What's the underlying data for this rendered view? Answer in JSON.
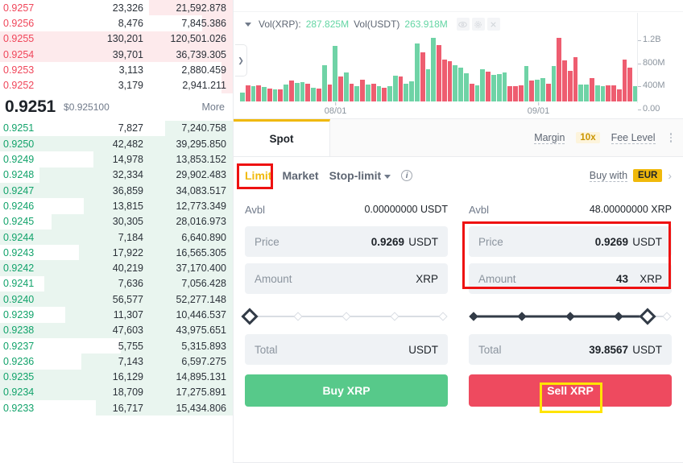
{
  "orderbook": {
    "asks": [
      {
        "price": "0.9257",
        "amount": "23,326",
        "total": "21,592.878",
        "depth": 36
      },
      {
        "price": "0.9256",
        "amount": "8,476",
        "total": "7,845.386",
        "depth": 13
      },
      {
        "price": "0.9255",
        "amount": "130,201",
        "total": "120,501.026",
        "depth": 100
      },
      {
        "price": "0.9254",
        "amount": "39,701",
        "total": "36,739.305",
        "depth": 100
      },
      {
        "price": "0.9253",
        "amount": "3,113",
        "total": "2,880.459",
        "depth": 5
      },
      {
        "price": "0.9252",
        "amount": "3,179",
        "total": "2,941.211",
        "depth": 5
      }
    ],
    "last_price": "0.9251",
    "last_price_fiat": "$0.925100",
    "more_label": "More",
    "bids": [
      {
        "price": "0.9251",
        "amount": "7,827",
        "total": "7,240.758",
        "depth": 29
      },
      {
        "price": "0.9250",
        "amount": "42,482",
        "total": "39,295.850",
        "depth": 100
      },
      {
        "price": "0.9249",
        "amount": "14,978",
        "total": "13,853.152",
        "depth": 60
      },
      {
        "price": "0.9248",
        "amount": "32,334",
        "total": "29,902.483",
        "depth": 83
      },
      {
        "price": "0.9247",
        "amount": "36,859",
        "total": "34,083.517",
        "depth": 100
      },
      {
        "price": "0.9246",
        "amount": "13,815",
        "total": "12,773.349",
        "depth": 64
      },
      {
        "price": "0.9245",
        "amount": "30,305",
        "total": "28,016.973",
        "depth": 78
      },
      {
        "price": "0.9244",
        "amount": "7,184",
        "total": "6,640.890",
        "depth": 100
      },
      {
        "price": "0.9243",
        "amount": "17,922",
        "total": "16,565.305",
        "depth": 66
      },
      {
        "price": "0.9242",
        "amount": "40,219",
        "total": "37,170.400",
        "depth": 100
      },
      {
        "price": "0.9241",
        "amount": "7,636",
        "total": "7,056.428",
        "depth": 81
      },
      {
        "price": "0.9240",
        "amount": "56,577",
        "total": "52,277.148",
        "depth": 100
      },
      {
        "price": "0.9239",
        "amount": "11,307",
        "total": "10,446.537",
        "depth": 72
      },
      {
        "price": "0.9238",
        "amount": "47,603",
        "total": "43,975.651",
        "depth": 100
      },
      {
        "price": "0.9237",
        "amount": "5,755",
        "total": "5,315.893",
        "depth": 48
      },
      {
        "price": "0.9236",
        "amount": "7,143",
        "total": "6,597.275",
        "depth": 65
      },
      {
        "price": "0.9235",
        "amount": "16,129",
        "total": "14,895.131",
        "depth": 100
      },
      {
        "price": "0.9234",
        "amount": "18,709",
        "total": "17,275.891",
        "depth": 100
      },
      {
        "price": "0.9233",
        "amount": "16,717",
        "total": "15,434.806",
        "depth": 59
      }
    ]
  },
  "chart": {
    "legend": {
      "vol_base_label": "Vol(XRP):",
      "vol_base_value": "287.825M",
      "vol_quote_label": "Vol(USDT)",
      "vol_quote_value": "263.918M"
    },
    "icons": [
      "eye-icon",
      "gear-icon",
      "close-icon"
    ],
    "chart_data": {
      "type": "bar",
      "title": "Volume",
      "xlabel": "",
      "ylabel": "",
      "ylim": [
        0,
        1350000000
      ],
      "yticks": [
        "0.00",
        "400M",
        "800M",
        "1.2B"
      ],
      "xticks": [
        "08/01",
        "09/01"
      ],
      "grid": false,
      "legend_position": "top-left",
      "series": [
        {
          "name": "Volume",
          "values": [
            170,
            320,
            300,
            320,
            280,
            250,
            230,
            240,
            330,
            400,
            360,
            370,
            340,
            260,
            250,
            700,
            330,
            1080,
            490,
            560,
            340,
            300,
            430,
            330,
            350,
            290,
            270,
            290,
            500,
            480,
            340,
            390,
            1120,
            960,
            620,
            1230,
            1100,
            820,
            790,
            700,
            650,
            550,
            340,
            320,
            620,
            580,
            520,
            540,
            560,
            300,
            300,
            310,
            690,
            400,
            420,
            460,
            340,
            690,
            1230,
            800,
            590,
            860,
            330,
            330,
            460,
            310,
            300,
            310,
            310,
            240,
            820,
            650,
            290
          ],
          "directions": [
            "up",
            "down",
            "up",
            "down",
            "up",
            "down",
            "up",
            "down",
            "up",
            "down",
            "up",
            "up",
            "down",
            "up",
            "down",
            "up",
            "down",
            "up",
            "down",
            "up",
            "down",
            "up",
            "down",
            "up",
            "down",
            "up",
            "down",
            "up",
            "up",
            "down",
            "up",
            "up",
            "up",
            "down",
            "up",
            "up",
            "down",
            "down",
            "down",
            "up",
            "up",
            "up",
            "down",
            "up",
            "up",
            "down",
            "up",
            "up",
            "up",
            "down",
            "down",
            "down",
            "up",
            "down",
            "up",
            "up",
            "down",
            "up",
            "down",
            "down",
            "down",
            "down",
            "up",
            "up",
            "down",
            "up",
            "up",
            "down",
            "down",
            "down",
            "down",
            "down",
            "up"
          ]
        }
      ]
    }
  },
  "tabbar": {
    "spot_label": "Spot",
    "margin_label": "Margin",
    "margin_badge": "10x",
    "fee_level_label": "Fee Level"
  },
  "ordertype": {
    "limit": "Limit",
    "market": "Market",
    "stop_limit": "Stop-limit",
    "buy_with_label": "Buy with",
    "buy_with_currency": "EUR"
  },
  "buy_form": {
    "avbl_label": "Avbl",
    "avbl_value": "0.00000000 USDT",
    "price_label": "Price",
    "price_value": "0.9269",
    "price_unit": "USDT",
    "amount_label": "Amount",
    "amount_value": "",
    "amount_unit": "XRP",
    "slider_percent": 0,
    "total_label": "Total",
    "total_value": "",
    "total_unit": "USDT",
    "button_label": "Buy XRP"
  },
  "sell_form": {
    "avbl_label": "Avbl",
    "avbl_value": "48.00000000 XRP",
    "price_label": "Price",
    "price_value": "0.9269",
    "price_unit": "USDT",
    "amount_label": "Amount",
    "amount_value": "43",
    "amount_unit": "XRP",
    "slider_percent": 90,
    "total_label": "Total",
    "total_value": "39.8567",
    "total_unit": "USDT",
    "button_label": "Sell XRP"
  },
  "colors": {
    "bid_green": "#12a36b",
    "ask_red": "#f0465a",
    "accent_yellow": "#f0b90b",
    "buy_button": "#57c98a",
    "sell_button": "#ee4a5f",
    "highlight_red": "#ee1111",
    "highlight_yellow": "#ffe400"
  }
}
